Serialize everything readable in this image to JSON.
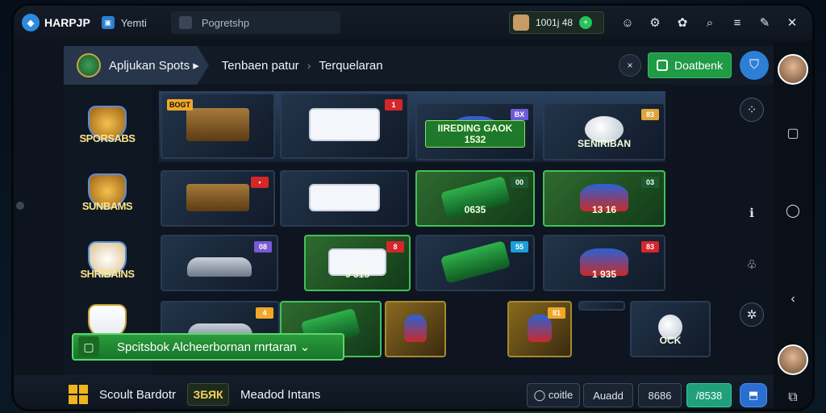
{
  "topbar": {
    "logo_text": "HARPJP",
    "tab_label": "Yemti",
    "address_text": "Pogretshp",
    "balance_text": "1001j 48"
  },
  "nav": {
    "crumb1": "Apljukan Spots ▸",
    "crumb2": "Tenbaen patur",
    "crumb3": "Terquelaran",
    "round_btn_label": "×",
    "dashboard_label": "Doatbenk"
  },
  "categories": [
    "SPORSABS",
    "SUNBAMS",
    "SHRIBAINS",
    ""
  ],
  "tiles": [
    {
      "badge": "",
      "badge_color": "",
      "left_badge": "BOGT",
      "caption": ""
    },
    {
      "badge": "1",
      "badge_color": "#d6262a",
      "left_badge": "",
      "caption": ""
    },
    {
      "badge": "BX",
      "badge_color": "#6f5ad6",
      "left_badge": "",
      "caption": "IIREDING GAOK 1532"
    },
    {
      "badge": "83",
      "badge_color": "#e0a53a",
      "left_badge": "",
      "caption": "SENIRIBAN"
    },
    {
      "badge": "•",
      "badge_color": "#d6262a",
      "left_badge": "",
      "caption": ""
    },
    {
      "badge": "",
      "badge_color": "",
      "left_badge": "",
      "caption": ""
    },
    {
      "badge": "00",
      "badge_color": "#1d5a2e",
      "left_badge": "",
      "caption": "0635"
    },
    {
      "badge": "03",
      "badge_color": "#1d5a2e",
      "left_badge": "",
      "caption": "13 16"
    },
    {
      "badge": "08",
      "badge_color": "#7a5ad6",
      "left_badge": "",
      "caption": ""
    },
    {
      "badge": "8",
      "badge_color": "#d6262a",
      "left_badge": "",
      "caption": "9 315"
    },
    {
      "badge": "55",
      "badge_color": "#1e9ed6",
      "left_badge": "",
      "caption": ""
    },
    {
      "badge": "83",
      "badge_color": "#d6262a",
      "left_badge": "",
      "caption": "1 935"
    },
    {
      "badge": "4",
      "badge_color": "#f0a828",
      "left_badge": "",
      "caption": ""
    },
    {
      "badge": "",
      "badge_color": "",
      "left_badge": "",
      "caption": ""
    },
    {
      "badge": "",
      "badge_color": "",
      "left_badge": "",
      "caption": ""
    },
    {
      "badge": "81",
      "badge_color": "#f0a828",
      "left_badge": "",
      "caption": ""
    },
    {
      "badge": "",
      "badge_color": "",
      "left_badge": "",
      "caption": ""
    },
    {
      "badge": "",
      "badge_color": "",
      "left_badge": "",
      "caption": "OCK"
    }
  ],
  "promo": {
    "text": "Spcitsbok Alcheerbornan rnrtaran ⌄"
  },
  "bottom": {
    "title": "Scoult Bardotr",
    "value": "ЗБЯК",
    "mode": "Meadod Intans",
    "pill1": "◯ coitle",
    "pill2": "Auadd",
    "pill3": "8686",
    "pill4": "/8538",
    "pill5": "⬒"
  },
  "colors": {
    "accent_green": "#1f9a45",
    "accent_blue": "#2d7fd6"
  }
}
